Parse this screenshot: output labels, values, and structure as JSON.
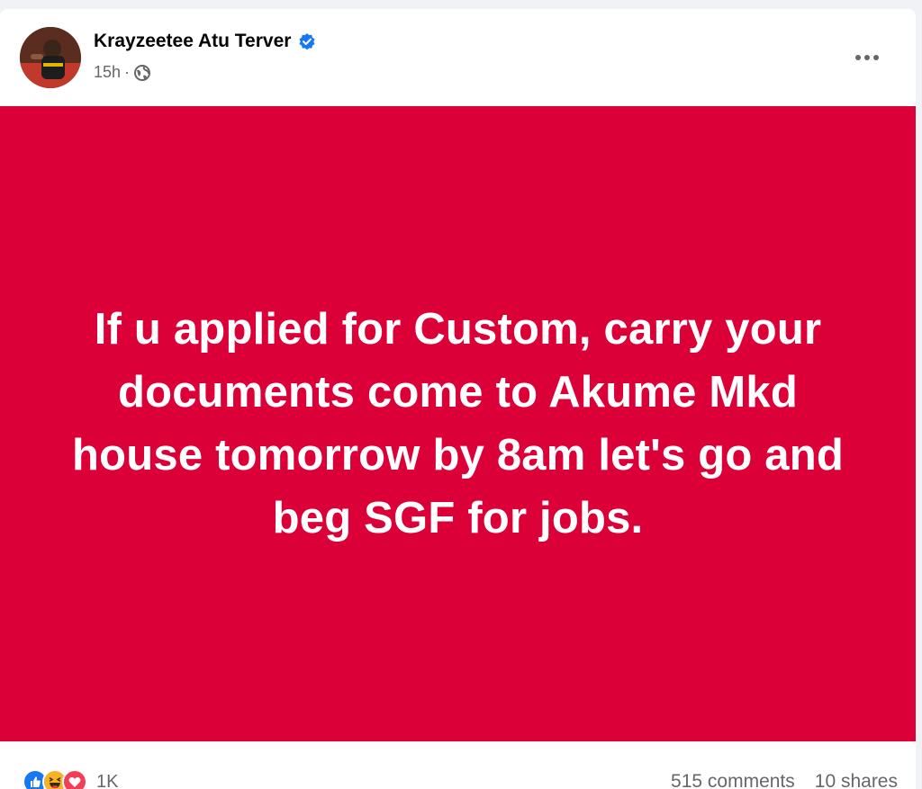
{
  "post": {
    "author_name": "Krayzeetee Atu Terver",
    "timestamp": "15h",
    "separator": "·",
    "privacy_icon": "globe-icon",
    "verified_icon": "verified-badge-icon",
    "more_icon": "more-options-icon",
    "background_color": "#dc0038",
    "text": "If u applied for Custom, carry your documents come to Akume Mkd house tomorrow by 8am let's go and beg SGF for jobs."
  },
  "footer": {
    "reaction_icons": [
      "like-icon",
      "haha-icon",
      "love-icon"
    ],
    "reaction_count": "1K",
    "comments": "515 comments",
    "shares": "10 shares"
  },
  "colors": {
    "accent_blue": "#1877f2",
    "love_red": "#f33e58",
    "haha_yellow": "#f7b125",
    "muted_text": "#65676b"
  }
}
